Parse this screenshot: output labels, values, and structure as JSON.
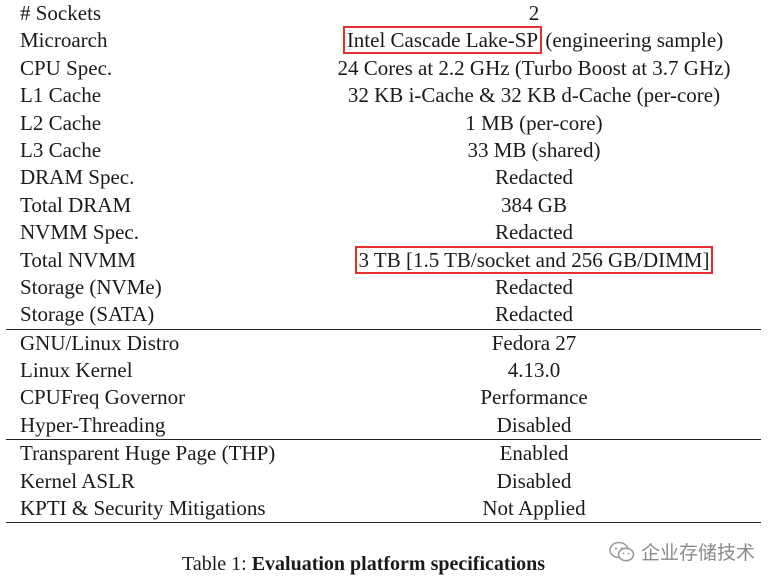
{
  "table": {
    "groups": [
      {
        "rows": [
          {
            "label": "# Sockets",
            "value": "2"
          },
          {
            "label": "Microarch",
            "value_highlight": "Intel Cascade Lake-SP",
            "value_rest": " (engineering sample)"
          },
          {
            "label": "CPU Spec.",
            "value": "24 Cores at 2.2 GHz (Turbo Boost at 3.7 GHz)"
          },
          {
            "label": "L1 Cache",
            "value": "32 KB i-Cache & 32 KB d-Cache (per-core)"
          },
          {
            "label": "L2 Cache",
            "value": "1 MB (per-core)"
          },
          {
            "label": "L3 Cache",
            "value": "33 MB (shared)"
          },
          {
            "label": "DRAM Spec.",
            "value": "Redacted"
          },
          {
            "label": "Total DRAM",
            "value": "384 GB"
          },
          {
            "label": "NVMM Spec.",
            "value": "Redacted"
          },
          {
            "label": "Total NVMM",
            "value_highlight": "3 TB [1.5 TB/socket and 256 GB/DIMM]"
          },
          {
            "label": "Storage (NVMe)",
            "value": "Redacted"
          },
          {
            "label": "Storage (SATA)",
            "value": "Redacted"
          }
        ]
      },
      {
        "rows": [
          {
            "label": "GNU/Linux Distro",
            "value": "Fedora 27"
          },
          {
            "label": "Linux Kernel",
            "value": "4.13.0"
          },
          {
            "label": "CPUFreq Governor",
            "value": "Performance"
          },
          {
            "label": "Hyper-Threading",
            "value": "Disabled"
          }
        ]
      },
      {
        "rows": [
          {
            "label": "Transparent Huge Page (THP)",
            "value": "Enabled"
          },
          {
            "label": "Kernel ASLR",
            "value": "Disabled"
          },
          {
            "label": "KPTI & Security Mitigations",
            "value": "Not Applied"
          }
        ]
      }
    ]
  },
  "caption": {
    "prefix": "Table 1: ",
    "title": "Evaluation platform specifications"
  },
  "watermark": {
    "icon": "wechat-icon",
    "text": "企业存储技术",
    "color": "#8a8a8a"
  },
  "highlight_color": "#e03030"
}
